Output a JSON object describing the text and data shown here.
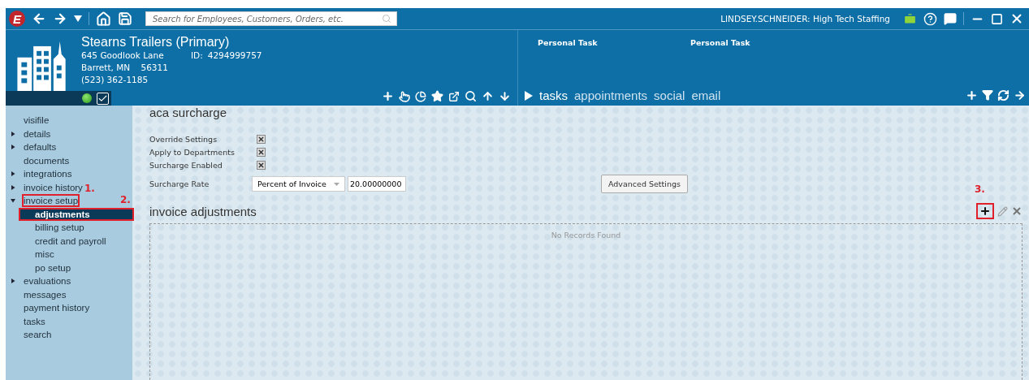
{
  "top_bar": {
    "logo": "E",
    "search": {
      "placeholder": "Search for Employees, Customers, Orders, etc."
    },
    "user": "LINDSEY.SCHNEIDER: High Tech Staffing"
  },
  "record": {
    "name": "Stearns Trailers (Primary)",
    "address_lines": [
      "645 Goodlook Lane",
      "Barrett, MN    56311",
      "(523) 362-1185"
    ],
    "id_label": "ID:",
    "id": "4294999757",
    "active": true,
    "checked": true
  },
  "activity": {
    "columns": [
      "Personal Task",
      "Personal Task"
    ],
    "tabs": [
      {
        "label": "tasks",
        "selected": true
      },
      {
        "label": "appointments",
        "selected": false
      },
      {
        "label": "social",
        "selected": false
      },
      {
        "label": "email",
        "selected": false
      }
    ]
  },
  "sidebar": {
    "items": [
      {
        "label": "visifile",
        "selected": false
      },
      {
        "label": "details",
        "expanded": false,
        "selected": false
      },
      {
        "label": "defaults",
        "expanded": false,
        "selected": false
      },
      {
        "label": "documents",
        "selected": false
      },
      {
        "label": "integrations",
        "expanded": false,
        "selected": false
      },
      {
        "label": "invoice history",
        "expanded": false,
        "selected": false
      },
      {
        "label": "invoice setup",
        "expanded": true,
        "selected": false,
        "callout": "1.",
        "children": [
          {
            "label": "adjustments",
            "selected": true,
            "callout": "2."
          },
          {
            "label": "billing setup",
            "selected": false
          },
          {
            "label": "credit and payroll",
            "selected": false
          },
          {
            "label": "misc",
            "selected": false
          },
          {
            "label": "po setup",
            "selected": false
          }
        ]
      },
      {
        "label": "evaluations",
        "expanded": false,
        "selected": false
      },
      {
        "label": "messages",
        "selected": false
      },
      {
        "label": "payment history",
        "selected": false
      },
      {
        "label": "tasks",
        "selected": false
      },
      {
        "label": "search",
        "selected": false
      }
    ]
  },
  "surcharge": {
    "title": "aca surcharge",
    "options": [
      {
        "label": "Override Settings",
        "checked": true
      },
      {
        "label": "Apply to Departments",
        "checked": true
      },
      {
        "label": "Surcharge Enabled",
        "checked": true
      }
    ],
    "rate_label": "Surcharge Rate",
    "rate_type": "Percent of Invoice",
    "rate_value": "20.00000000",
    "advanced_button": "Advanced Settings"
  },
  "adjustments": {
    "title": "invoice adjustments",
    "add_callout": "3.",
    "empty_text": "No Records Found"
  }
}
